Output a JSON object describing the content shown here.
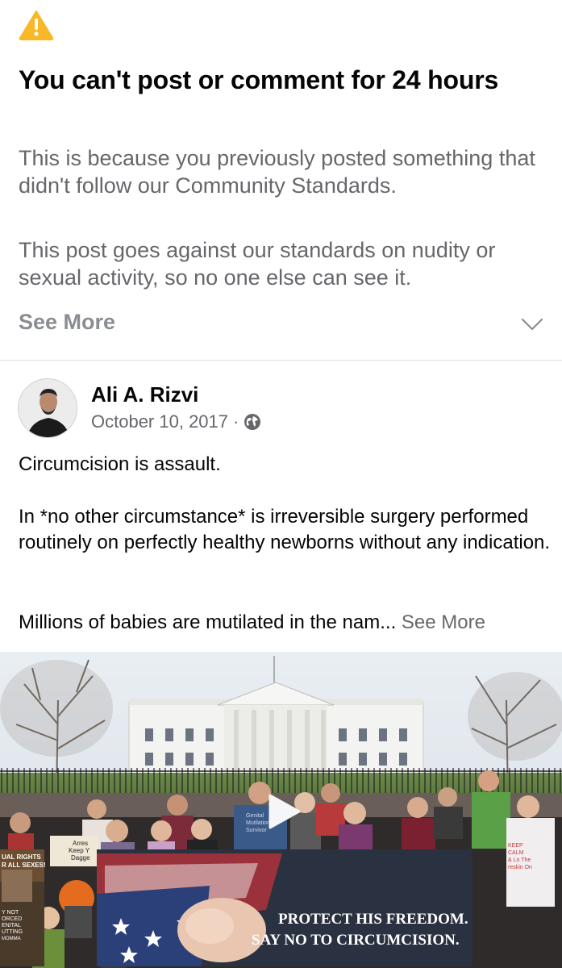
{
  "notice": {
    "title": "You can't post or comment for 24 hours",
    "paragraph1": "This is because you previously posted something that didn't follow our Community Standards.",
    "paragraph2": "This post goes against our standards on nudity or sexual activity, so no one else can see it.",
    "see_more": "See More",
    "icon": "warning-icon",
    "chevron_icon": "chevron-down-icon"
  },
  "post": {
    "author": "Ali A. Rizvi",
    "date": "October 10, 2017",
    "separator": "·",
    "privacy_icon": "globe-icon",
    "text_line1": "Circumcision is assault.",
    "text_para2": "In *no other circumstance* is irreversible surgery performed routinely on perfectly healthy newborns without any indication.",
    "text_para3": "Millions of babies are mutilated in the nam...",
    "see_more": "See More"
  },
  "video": {
    "play_icon": "play-icon",
    "banner_line1": "PROTECT HIS FREEDOM.",
    "banner_line2": "SAY NO TO CIRCUMCISION.",
    "sign_left_line1": "UAL RIGHTS",
    "sign_left_line2": "R ALL SEXES!",
    "sign_left_lower1": "Y NOT",
    "sign_left_lower2": "ORCED",
    "sign_left_lower3": "ENITAL",
    "sign_left_lower4": "UTTING",
    "sign_left_lower5": "MOMMA",
    "sign_mid_line1": "Arres",
    "sign_mid_line2": "Keep Y",
    "sign_mid_line3": "Dagge",
    "sign_right_line1": "KEEP",
    "sign_right_line2": "CALM",
    "sign_right_line3": "& Lo The",
    "sign_right_line4": "reskin On",
    "shirt_line1": "Genital",
    "shirt_line2": "Mutilation",
    "shirt_line3": "Survivor",
    "colors": {
      "sky": "#dfe6ee",
      "house": "#f3f3f1",
      "banner": "#2a3140"
    }
  }
}
